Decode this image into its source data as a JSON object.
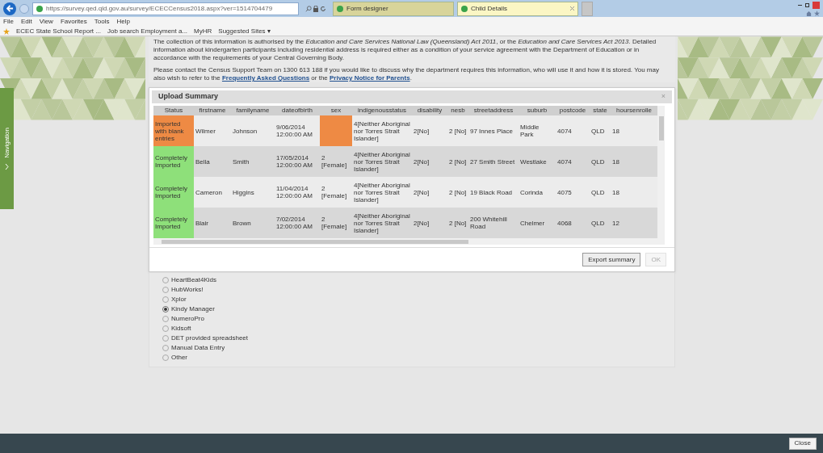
{
  "browser": {
    "url": "https://survey.qed.qld.gov.au/survey/ECECCensus2018.aspx?ver=1514704479",
    "tabs": [
      {
        "label": "Form designer",
        "selected": false
      },
      {
        "label": "Child Details",
        "selected": true
      }
    ],
    "menu": [
      "File",
      "Edit",
      "View",
      "Favorites",
      "Tools",
      "Help"
    ],
    "favorites": [
      "ECEC State School Report ...",
      "Job search Employment a...",
      "MyHR",
      "Suggested Sites ▾"
    ]
  },
  "navigation": {
    "label": "Navigation"
  },
  "intro": {
    "paragraph_1": "The collection of this information is authorised by the *Education and Care Services National Law (Queensland) Act 2011*, or the *Education and Care Services Act 2013*. Detailed information about kindergarten participants including residential address is required either as a condition of your service agreement with the Department of Education or in accordance with the requirements of your Central Governing Body.",
    "paragraph_2": {
      "before": "Please contact the Census Support Team on 1300 613 188 if you would like to discuss why the department requires this information, who will use it and how it is stored. You may also wish to refer to the ",
      "link_1": "Frequently Asked Questions",
      "middle": " or the ",
      "link_2": "Privacy Notice for Parents",
      "after": "."
    }
  },
  "dialog": {
    "title": "Upload Summary",
    "close": "×",
    "columns": [
      "Status",
      "firstname",
      "familyname",
      "dateofbirth",
      "sex",
      "indigenousstatus",
      "disability",
      "nesb",
      "streetaddress",
      "suburb",
      "postcode",
      "state",
      "hoursenrolle"
    ],
    "rows": [
      {
        "color": "#ee8a44",
        "cells": [
          "Imported with blank entries",
          "Wilmer",
          "Johnson",
          "9/06/2014 12:00:00 AM",
          "",
          "4[Neither Aboriginal nor Torres Strait Islander]",
          "2[No]",
          "2 [No]",
          "97 Innes Place",
          "Middle Park",
          "4074",
          "QLD",
          "18"
        ]
      },
      {
        "color": "#8ee07a",
        "cells": [
          "Completely Imported",
          "Bella",
          "Smith",
          "17/05/2014 12:00:00 AM",
          "2 [Female]",
          "4[Neither Aboriginal nor Torres Strait Islander]",
          "2[No]",
          "2 [No]",
          "27 Smith Street",
          "Westlake",
          "4074",
          "QLD",
          "18"
        ]
      },
      {
        "color": "#8ee07a",
        "cells": [
          "Completely Imported",
          "Cameron",
          "Higgins",
          "11/04/2014 12:00:00 AM",
          "2 [Female]",
          "4[Neither Aboriginal nor Torres Strait Islander]",
          "2[No]",
          "2 [No]",
          "19 Black Road",
          "Corinda",
          "4075",
          "QLD",
          "18"
        ]
      },
      {
        "color": "#8ee07a",
        "cells": [
          "Completely Imported",
          "Blair",
          "Brown",
          "7/02/2014 12:00:00 AM",
          "2 [Female]",
          "4[Neither Aboriginal nor Torres Strait Islander]",
          "2[No]",
          "2 [No]",
          "200 Whitehill Road",
          "Chelmer",
          "4068",
          "QLD",
          "12"
        ]
      }
    ],
    "buttons": [
      {
        "label": "Export summary",
        "disabled": false
      },
      {
        "label": "OK",
        "disabled": true
      }
    ]
  },
  "options": [
    {
      "label": "HeartBeat4Kids",
      "selected": false
    },
    {
      "label": "HubWorks!",
      "selected": false
    },
    {
      "label": "Xplor",
      "selected": false
    },
    {
      "label": "Kindy Manager",
      "selected": true
    },
    {
      "label": "NumeroPro",
      "selected": false
    },
    {
      "label": "Kidsoft",
      "selected": false
    },
    {
      "label": "DET provided spreadsheet",
      "selected": false
    },
    {
      "label": "Manual Data Entry",
      "selected": false
    },
    {
      "label": "Other",
      "selected": false
    }
  ],
  "footer": {
    "close": "Close"
  }
}
